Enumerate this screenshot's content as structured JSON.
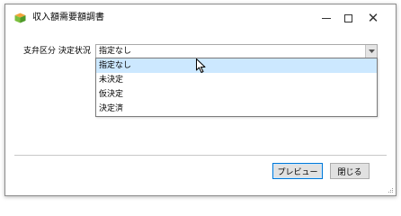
{
  "window": {
    "title": "収入額需要額調書",
    "controls": {
      "minimize_icon": "minimize-icon",
      "maximize_icon": "maximize-icon",
      "close_icon": "close-icon"
    }
  },
  "filter": {
    "label": "支弁区分 決定状況",
    "selected_value": "指定なし",
    "options": [
      {
        "label": "指定なし",
        "selected": true
      },
      {
        "label": "未決定",
        "selected": false
      },
      {
        "label": "仮決定",
        "selected": false
      },
      {
        "label": "決定済",
        "selected": false
      }
    ]
  },
  "buttons": {
    "preview": "プレビュー",
    "close": "閉じる"
  },
  "icons": {
    "app": "app-icon",
    "dropdown": "chevron-down-icon",
    "cursor": "mouse-cursor-icon",
    "grip": "resize-grip-icon"
  },
  "colors": {
    "selection": "#cce8ff",
    "default_button_border": "#0078d7"
  }
}
